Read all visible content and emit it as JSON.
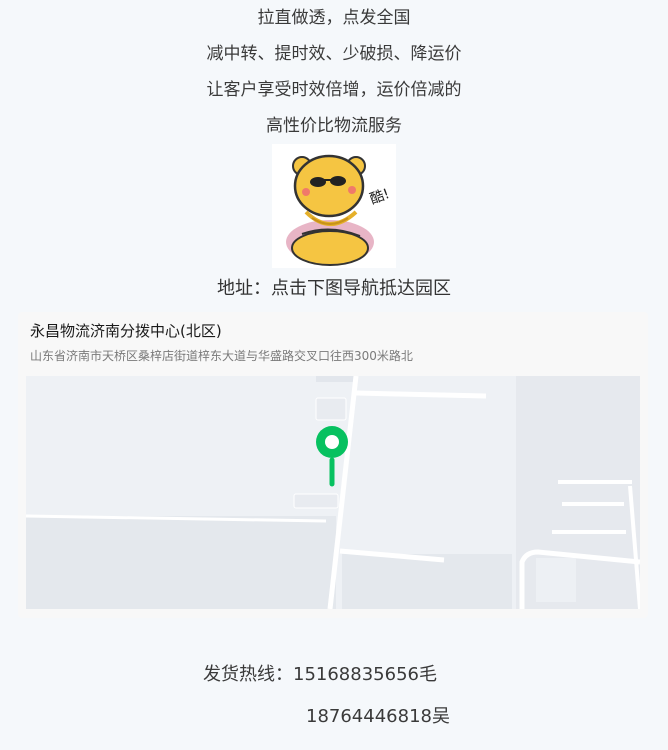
{
  "intro": {
    "lines": [
      "拉直做透，点发全国",
      "减中转、提时效、少破损、降运价",
      "让客户享受时效倍增，运价倍减的",
      "高性价比物流服务"
    ]
  },
  "sticker": {
    "text": "酷!",
    "icon": "cool-bear-sticker-icon"
  },
  "address_label": "地址：点击下图导航抵达园区",
  "map": {
    "title": "永昌物流济南分拨中心(北区)",
    "subtitle": "山东省济南市天桥区桑梓店街道梓东大道与华盛路交叉口往西300米路北",
    "pin_color": "#07c160"
  },
  "hotline": {
    "label": "发货热线：",
    "phone1": "15168835656毛",
    "phone2": "18764446818吴"
  }
}
